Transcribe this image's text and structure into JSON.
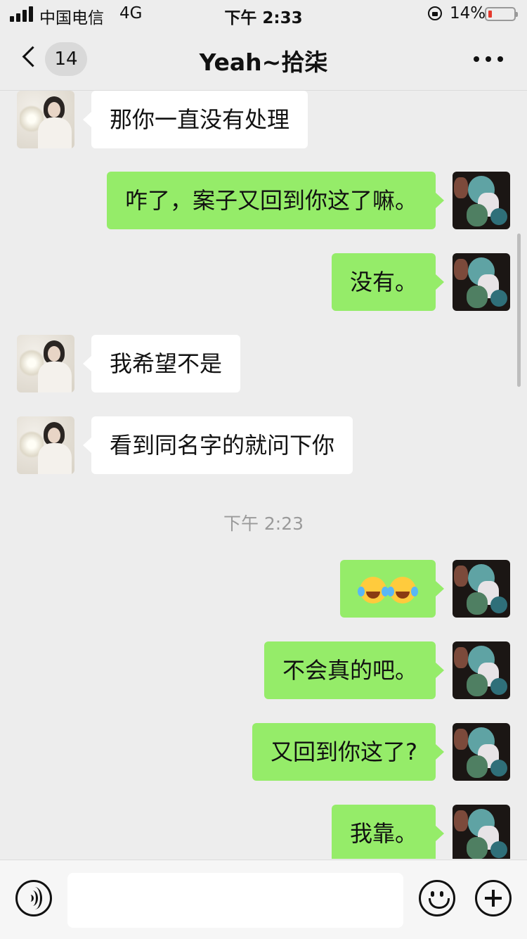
{
  "status_bar": {
    "carrier": "中国电信",
    "network": "4G",
    "time": "下午 2:33",
    "battery_percent": "14%"
  },
  "nav": {
    "unread_count": "14",
    "title": "Yeah~拾柒",
    "back_icon": "chevron-left-icon",
    "more_icon": "more-dots-icon"
  },
  "messages": [
    {
      "side": "left",
      "text": "那你一直没有处理"
    },
    {
      "side": "right",
      "text": "咋了，案子又回到你这了嘛。"
    },
    {
      "side": "right",
      "text": "没有。"
    },
    {
      "side": "left",
      "text": "我希望不是"
    },
    {
      "side": "left",
      "text": "看到同名字的就问下你"
    },
    {
      "type": "timestamp",
      "text": "下午 2:23"
    },
    {
      "side": "right",
      "emoji": [
        "crying-laughing-emoji",
        "crying-laughing-emoji"
      ]
    },
    {
      "side": "right",
      "text": "不会真的吧。"
    },
    {
      "side": "right",
      "text": "又回到你这了?"
    },
    {
      "side": "right",
      "text": "我靠。"
    }
  ],
  "input_bar": {
    "voice_icon": "voice-icon",
    "emoji_icon": "smile-icon",
    "plus_icon": "plus-icon",
    "text_value": ""
  },
  "colors": {
    "background": "#ededed",
    "sent_bubble": "#95ec69",
    "received_bubble": "#ffffff",
    "battery_low": "#e53a2e"
  }
}
